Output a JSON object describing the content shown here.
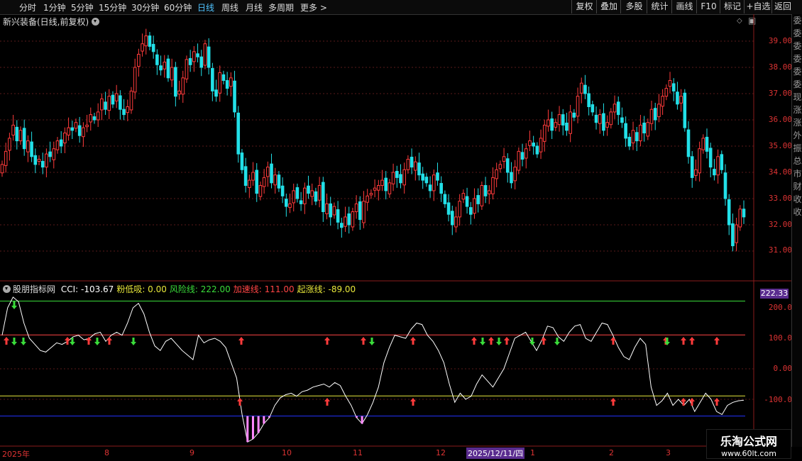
{
  "toolbar": {
    "periods": [
      "分时",
      "1分钟",
      "5分钟",
      "15分钟",
      "30分钟",
      "60分钟",
      "日线",
      "周线",
      "月线",
      "多周期",
      "更多"
    ],
    "active_period": "日线",
    "right_buttons": [
      "复权",
      "叠加",
      "多股",
      "统计",
      "画线",
      "F10",
      "标记",
      "+自选",
      "返回"
    ]
  },
  "main": {
    "title": "新兴装备(日线,前复权)"
  },
  "indicator": {
    "name": "股朋指标网",
    "items": [
      {
        "label": "CCI: -103.67",
        "color": "#ffffff"
      },
      {
        "label": "粉低吸: 0.00",
        "color": "#e8e83a"
      },
      {
        "label": "风险线: 222.00",
        "color": "#3adc3a"
      },
      {
        "label": "加速线: 111.00",
        "color": "#ff4444"
      },
      {
        "label": "起涨线: -89.00",
        "color": "#e8e83a"
      }
    ],
    "current_value": "222.33"
  },
  "price_axis": [
    "39.00",
    "38.00",
    "37.00",
    "36.00",
    "35.00",
    "34.00",
    "33.00",
    "32.00",
    "31.00"
  ],
  "cci_axis": [
    "200.0",
    "100.0",
    "0.00",
    "-100.0"
  ],
  "x_labels": [
    "2025年",
    "8",
    "9",
    "10",
    "11",
    "12",
    "1",
    "2",
    "3"
  ],
  "crosshair_date": "2025/12/11/四",
  "sidebar_chars": [
    "委",
    "委",
    "委",
    "委",
    "委",
    "委",
    "现",
    "涨",
    "涨",
    "外",
    "振",
    "总",
    "市",
    "财",
    "收",
    "收"
  ],
  "watermark": {
    "title": "乐淘公式网",
    "url": "www.60lt.com"
  },
  "colors": {
    "up": "#ff3b3b",
    "down": "#22e0e8",
    "cci": "#ffffff",
    "risk": "#3adc3a",
    "accel": "#ff4444",
    "start": "#e8e83a",
    "low": "#2233ff",
    "pink": "#ff88ff"
  }
}
